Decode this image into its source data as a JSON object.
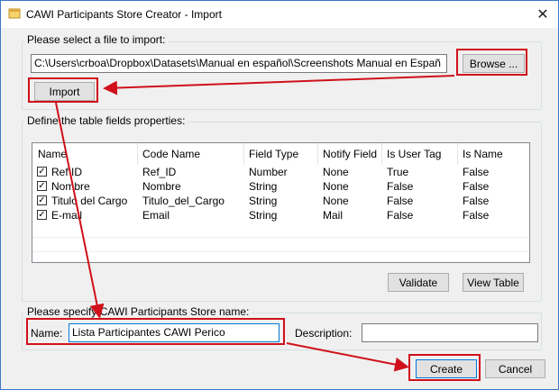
{
  "window": {
    "title": "CAWI Participants Store Creator - Import"
  },
  "import_group": {
    "label": "Please select a file to import:",
    "file_path": "C:\\Users\\crboa\\Dropbox\\Datasets\\Manual en español\\Screenshots Manual en Españ",
    "browse_label": "Browse ...",
    "import_label": "Import"
  },
  "fields_group": {
    "label": "Define the table fields properties:",
    "columns": [
      "Name",
      "Code Name",
      "Field Type",
      "Notify Field",
      "Is User Tag",
      "Is Name"
    ],
    "rows": [
      {
        "checked": true,
        "name": "Ref ID",
        "code_name": "Ref_ID",
        "field_type": "Number",
        "notify_field": "None",
        "is_user_tag": "True",
        "is_name": "False"
      },
      {
        "checked": true,
        "name": "Nombre",
        "code_name": "Nombre",
        "field_type": "String",
        "notify_field": "None",
        "is_user_tag": "False",
        "is_name": "False"
      },
      {
        "checked": true,
        "name": "Titulo del Cargo",
        "code_name": "Titulo_del_Cargo",
        "field_type": "String",
        "notify_field": "None",
        "is_user_tag": "False",
        "is_name": "False"
      },
      {
        "checked": true,
        "name": "E-mail",
        "code_name": "Email",
        "field_type": "String",
        "notify_field": "Mail",
        "is_user_tag": "False",
        "is_name": "False"
      }
    ],
    "validate_label": "Validate",
    "view_table_label": "View Table"
  },
  "store_group": {
    "label": "Please specify CAWI Participants Store name:",
    "name_label": "Name:",
    "name_value": "Lista Participantes CAWI Perico",
    "description_label": "Description:",
    "description_value": ""
  },
  "footer": {
    "create_label": "Create",
    "cancel_label": "Cancel"
  },
  "colors": {
    "highlight": "#d0101a",
    "accent": "#0078d7"
  }
}
